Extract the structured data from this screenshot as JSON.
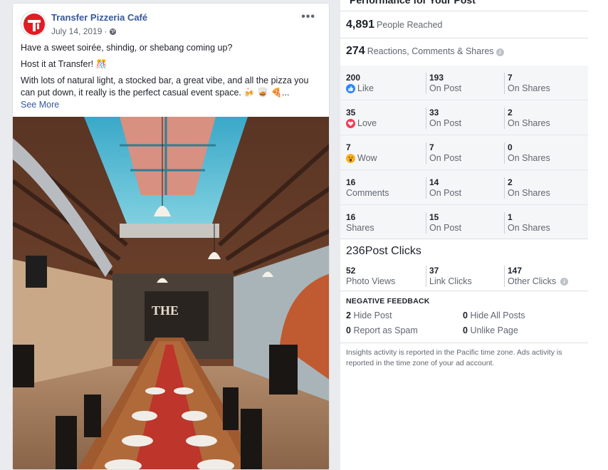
{
  "post": {
    "page_name": "Transfer Pizzeria Café",
    "date": "July 14, 2019",
    "more_label": "•••",
    "lines": [
      "Have a sweet soirée, shindig, or shebang coming up?",
      "Host it at Transfer! 🎊",
      "With lots of natural light, a stocked bar, a great vibe, and all the pizza you can put down, it really is the perfect casual event space. 🍻 🥃 🍕..."
    ],
    "see_more": "See More"
  },
  "insights": {
    "title": "Performance for Your Post",
    "reached_count": "4,891",
    "reached_label": "People Reached",
    "engagement_count": "274",
    "engagement_label": "Reactions, Comments & Shares",
    "reactions": [
      {
        "icon": "like-icon",
        "total": "200",
        "label": "Like",
        "on_post": "193",
        "on_post_label": "On Post",
        "on_shares": "7",
        "on_shares_label": "On Shares"
      },
      {
        "icon": "love-icon",
        "total": "35",
        "label": "Love",
        "on_post": "33",
        "on_post_label": "On Post",
        "on_shares": "2",
        "on_shares_label": "On Shares"
      },
      {
        "icon": "wow-icon",
        "total": "7",
        "label": "Wow",
        "on_post": "7",
        "on_post_label": "On Post",
        "on_shares": "0",
        "on_shares_label": "On Shares"
      },
      {
        "icon": "",
        "total": "16",
        "label": "Comments",
        "on_post": "14",
        "on_post_label": "On Post",
        "on_shares": "2",
        "on_shares_label": "On Shares"
      },
      {
        "icon": "",
        "total": "16",
        "label": "Shares",
        "on_post": "15",
        "on_post_label": "On Post",
        "on_shares": "1",
        "on_shares_label": "On Shares"
      }
    ],
    "clicks_count": "236",
    "clicks_label": "Post Clicks",
    "clicks": [
      {
        "value": "52",
        "label": "Photo Views"
      },
      {
        "value": "37",
        "label": "Link Clicks"
      },
      {
        "value": "147",
        "label": "Other Clicks"
      }
    ],
    "negative_title": "NEGATIVE FEEDBACK",
    "negative": [
      {
        "value": "2",
        "label": "Hide Post"
      },
      {
        "value": "0",
        "label": "Hide All Posts"
      },
      {
        "value": "0",
        "label": "Report as Spam"
      },
      {
        "value": "0",
        "label": "Unlike Page"
      }
    ],
    "footnote": "Insights activity is reported in the Pacific time zone. Ads activity is reported in the time zone of your ad account."
  },
  "colors": {
    "link": "#365899",
    "like": "#2d88ff",
    "love": "#f33e58",
    "wow": "#f7b125",
    "logo_red": "#e31b23"
  }
}
